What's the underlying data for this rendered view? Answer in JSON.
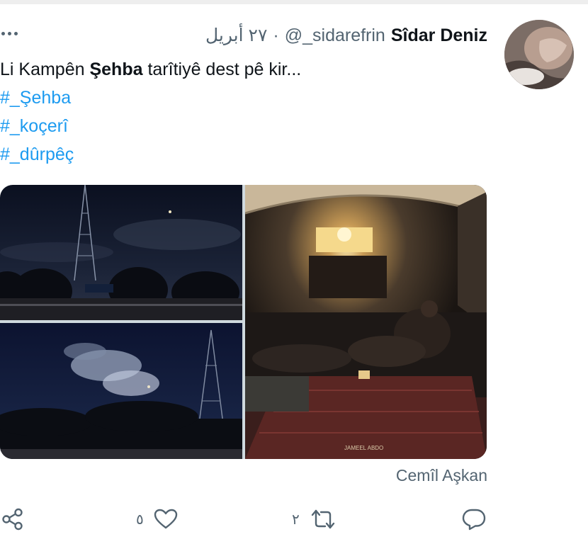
{
  "tweet": {
    "author_name": "Sîdar Deniz",
    "handle": "@_sidarefrin",
    "separator": "·",
    "date": "٢٧ أبريل",
    "text_prefix": "Li Kampên ",
    "text_bold": "Şehba",
    "text_suffix": " tarîtiyê dest pê kir...",
    "hashtags": [
      "#_Şehba",
      "#_koçerî",
      "#_dûrpêç"
    ],
    "photo_watermark": "JAMEEL ABDO",
    "photo_credit": "Cemîl Aşkan"
  },
  "actions": {
    "share_icon": "share-icon",
    "like_icon": "heart-icon",
    "like_count": "٥",
    "retweet_icon": "retweet-icon",
    "retweet_count": "٢",
    "reply_icon": "reply-icon"
  },
  "colors": {
    "accent": "#1d9bf0",
    "secondary_text": "#536471",
    "primary_text": "#0f1419"
  }
}
